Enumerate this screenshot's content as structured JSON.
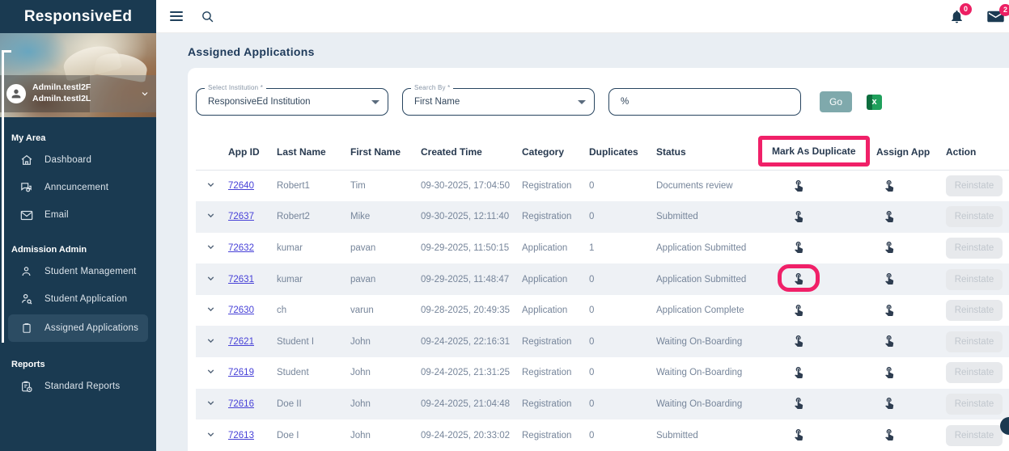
{
  "app": {
    "logo_text": "ResponsiveEd"
  },
  "topbar": {
    "notification_badge": "0",
    "mail_badge": "2"
  },
  "sidebar": {
    "user_line1": "Admiln.testl2F",
    "user_line2": "Admiln.testl2L",
    "sections": [
      {
        "label": "My Area",
        "items": [
          {
            "label": "Dashboard",
            "icon": "home-icon",
            "active": false
          },
          {
            "label": "Anncuncement",
            "icon": "announcement-icon",
            "active": false
          },
          {
            "label": "Email",
            "icon": "email-icon",
            "active": false
          }
        ]
      },
      {
        "label": "Admission Admin",
        "items": [
          {
            "label": "Student Management",
            "icon": "person-icon",
            "active": false
          },
          {
            "label": "Student Application",
            "icon": "person-search-icon",
            "active": false
          },
          {
            "label": "Assigned Applications",
            "icon": "clipboard-icon",
            "active": true
          }
        ]
      },
      {
        "label": "Reports",
        "items": [
          {
            "label": "Standard Reports",
            "icon": "report-icon",
            "active": false
          }
        ]
      }
    ]
  },
  "page": {
    "title": "Assigned Applications"
  },
  "filters": {
    "institution": {
      "label": "Select Institution *",
      "value": "ResponsiveEd Institution"
    },
    "search_by": {
      "label": "Search By *",
      "value": "First Name"
    },
    "search_value": "%",
    "go_label": "Go",
    "excel_glyph": "x"
  },
  "table": {
    "columns": [
      "App ID",
      "Last Name",
      "First Name",
      "Created Time",
      "Category",
      "Duplicates",
      "Status",
      "Mark As Duplicate",
      "Assign App",
      "Action"
    ],
    "action_label": "Reinstate",
    "rows": [
      {
        "app_id": "72640",
        "last_name": "Robert1",
        "first_name": "Tim",
        "created": "09-30-2025, 17:04:50",
        "category": "Registration",
        "duplicates": "0",
        "status": "Documents review",
        "annotated": false
      },
      {
        "app_id": "72637",
        "last_name": "Robert2",
        "first_name": "Mike",
        "created": "09-30-2025, 12:11:40",
        "category": "Registration",
        "duplicates": "0",
        "status": "Submitted",
        "annotated": false
      },
      {
        "app_id": "72632",
        "last_name": "kumar",
        "first_name": "pavan",
        "created": "09-29-2025, 11:50:15",
        "category": "Application",
        "duplicates": "1",
        "status": "Application Submitted",
        "annotated": false
      },
      {
        "app_id": "72631",
        "last_name": "kumar",
        "first_name": "pavan",
        "created": "09-29-2025, 11:48:47",
        "category": "Application",
        "duplicates": "0",
        "status": "Application Submitted",
        "annotated": true
      },
      {
        "app_id": "72630",
        "last_name": "ch",
        "first_name": "varun",
        "created": "09-28-2025, 20:49:35",
        "category": "Application",
        "duplicates": "0",
        "status": "Application Complete",
        "annotated": false
      },
      {
        "app_id": "72621",
        "last_name": "Student I",
        "first_name": "John",
        "created": "09-24-2025, 22:16:31",
        "category": "Registration",
        "duplicates": "0",
        "status": "Waiting On-Boarding",
        "annotated": false
      },
      {
        "app_id": "72619",
        "last_name": "Student",
        "first_name": "John",
        "created": "09-24-2025, 21:31:25",
        "category": "Registration",
        "duplicates": "0",
        "status": "Waiting On-Boarding",
        "annotated": false
      },
      {
        "app_id": "72616",
        "last_name": "Doe II",
        "first_name": "John",
        "created": "09-24-2025, 21:04:48",
        "category": "Registration",
        "duplicates": "0",
        "status": "Waiting On-Boarding",
        "annotated": false
      },
      {
        "app_id": "72613",
        "last_name": "Doe I",
        "first_name": "John",
        "created": "09-24-2025, 20:33:02",
        "category": "Registration",
        "duplicates": "0",
        "status": "Submitted",
        "annotated": false
      }
    ]
  },
  "annotations": {
    "highlight_color": "#f02068",
    "highlighted_header": "Mark As Duplicate",
    "highlighted_row_app_id": "72631",
    "highlighted_column": "Mark As Duplicate"
  }
}
